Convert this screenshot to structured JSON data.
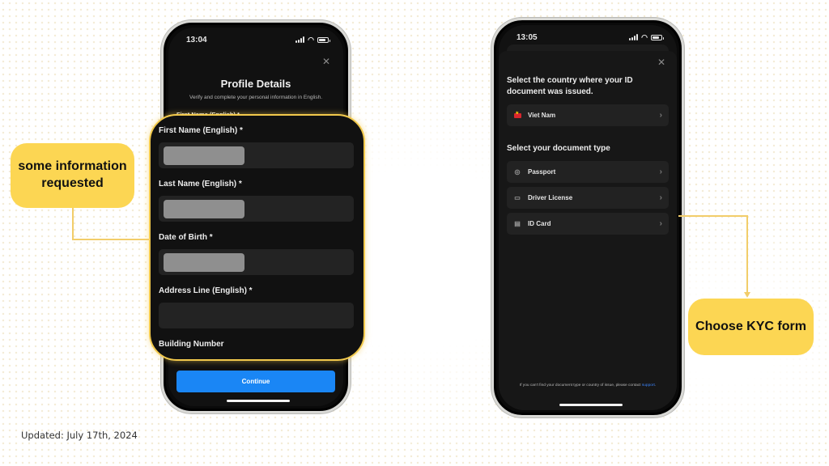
{
  "footer": {
    "updated": "Updated: July 17th, 2024"
  },
  "callouts": {
    "left": "some information requested",
    "right": "Choose KYC form",
    "accent": "#fcd653"
  },
  "left_phone": {
    "time": "13:04",
    "title": "Profile Details",
    "subtitle": "Verify and complete your personal information in English.",
    "first_label_preview": "First Name (English) *",
    "continue": "Continue",
    "continue_color": "#1a86f5",
    "zoom_fields": [
      {
        "label": "First Name (English) *",
        "value": "[redacted]"
      },
      {
        "label": "Last Name (English) *",
        "value": "[redacted]"
      },
      {
        "label": "Date of Birth *",
        "value": "[redacted]"
      },
      {
        "label": "Address Line (English) *",
        "value": ""
      },
      {
        "label": "Building Number"
      }
    ]
  },
  "right_phone": {
    "time": "13:05",
    "country_heading": "Select the country where your ID document was issued.",
    "country": {
      "label": "Viet Nam",
      "icon": "vietnam-flag-icon"
    },
    "doc_heading": "Select your document type",
    "doc_types": [
      {
        "label": "Passport",
        "icon": "globe-icon"
      },
      {
        "label": "Driver License",
        "icon": "car-icon"
      },
      {
        "label": "ID Card",
        "icon": "id-card-icon"
      }
    ],
    "footer_text": "If you can't find your document type or country of issue, please contact ",
    "footer_link": "support",
    "footer_end": "."
  }
}
